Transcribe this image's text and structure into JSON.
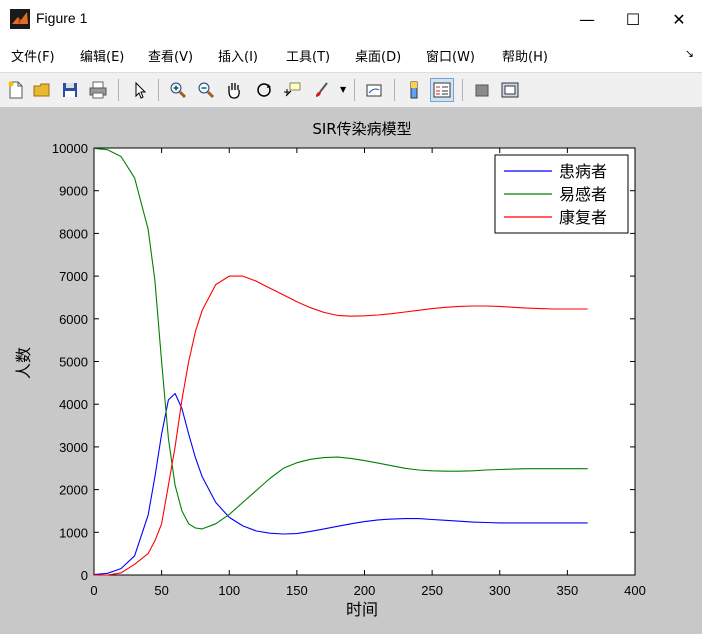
{
  "window": {
    "title": "Figure 1",
    "minimize": "—",
    "maximize": "☐",
    "close": "✕"
  },
  "menu": {
    "items": [
      "文件(F)",
      "编辑(E)",
      "查看(V)",
      "插入(I)",
      "工具(T)",
      "桌面(D)",
      "窗口(W)",
      "帮助(H)"
    ],
    "overflow": "↘"
  },
  "toolbar": {
    "buttons": [
      "new-figure",
      "open",
      "save",
      "print",
      "select-arrow",
      "zoom-in",
      "zoom-out",
      "pan",
      "rotate-3d",
      "data-cursor",
      "brush",
      "link-plot",
      "colorbar",
      "legend",
      "hide-plot-tools",
      "show-plot-tools"
    ]
  },
  "colors": {
    "infected": "#0000ff",
    "susceptible": "#008000",
    "recovered": "#ff0000"
  },
  "chart_data": {
    "type": "line",
    "title": "SIR传染病模型",
    "xlabel": "时间",
    "ylabel": "人数",
    "xlim": [
      0,
      400
    ],
    "ylim": [
      0,
      10000
    ],
    "xticks": [
      0,
      50,
      100,
      150,
      200,
      250,
      300,
      350,
      400
    ],
    "yticks": [
      0,
      1000,
      2000,
      3000,
      4000,
      5000,
      6000,
      7000,
      8000,
      9000,
      10000
    ],
    "grid": false,
    "legend_position": "top-right",
    "x": [
      0,
      10,
      20,
      30,
      40,
      45,
      50,
      55,
      60,
      65,
      70,
      75,
      80,
      90,
      100,
      110,
      120,
      130,
      140,
      150,
      160,
      170,
      180,
      190,
      200,
      210,
      220,
      230,
      240,
      250,
      260,
      270,
      280,
      290,
      300,
      310,
      320,
      330,
      340,
      350,
      365
    ],
    "series": [
      {
        "name": "患病者",
        "color": "#0000ff",
        "values": [
          10,
          40,
          150,
          450,
          1400,
          2300,
          3300,
          4100,
          4250,
          3900,
          3300,
          2750,
          2300,
          1700,
          1350,
          1150,
          1030,
          980,
          960,
          970,
          1020,
          1080,
          1140,
          1200,
          1250,
          1290,
          1310,
          1320,
          1320,
          1300,
          1280,
          1260,
          1240,
          1230,
          1220,
          1220,
          1220,
          1220,
          1220,
          1220,
          1220
        ]
      },
      {
        "name": "易感者",
        "color": "#008000",
        "values": [
          9990,
          9960,
          9800,
          9300,
          8100,
          6900,
          5000,
          3200,
          2100,
          1500,
          1200,
          1100,
          1080,
          1200,
          1420,
          1700,
          1980,
          2260,
          2500,
          2630,
          2710,
          2750,
          2760,
          2730,
          2680,
          2620,
          2560,
          2500,
          2460,
          2440,
          2430,
          2430,
          2440,
          2460,
          2470,
          2480,
          2490,
          2490,
          2490,
          2490,
          2490
        ]
      },
      {
        "name": "康复者",
        "color": "#ff0000",
        "values": [
          0,
          0,
          50,
          250,
          500,
          800,
          1200,
          2100,
          3000,
          4100,
          5000,
          5700,
          6200,
          6800,
          7000,
          7000,
          6880,
          6720,
          6560,
          6400,
          6260,
          6150,
          6080,
          6060,
          6070,
          6090,
          6120,
          6160,
          6200,
          6240,
          6270,
          6290,
          6300,
          6300,
          6290,
          6270,
          6250,
          6240,
          6230,
          6230,
          6230
        ]
      }
    ]
  }
}
